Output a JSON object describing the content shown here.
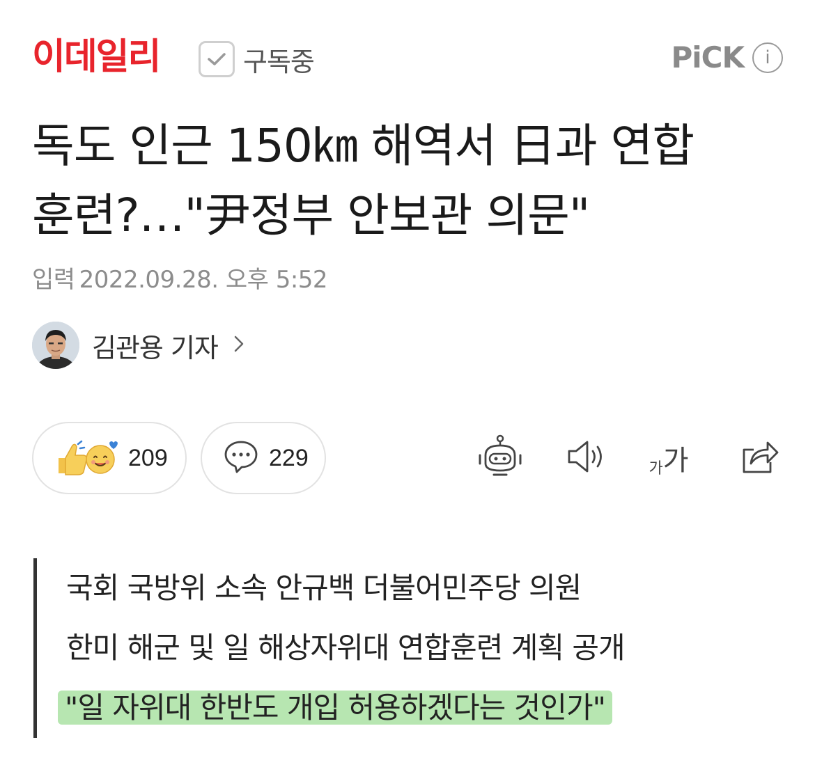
{
  "header": {
    "publisher": "이데일리",
    "subscribe_label": "구독중",
    "pick_label": "PiCK",
    "info_glyph": "i"
  },
  "article": {
    "headline_line1": "독도 인근 150㎞ 해역서 日과 연합",
    "headline_line2": "훈련?…\"尹정부 안보관 의문\"",
    "date_label": "입력",
    "date_value": "2022.09.28. 오후 5:52",
    "author": "김관용 기자"
  },
  "reactions": {
    "like_count": "209",
    "comment_count": "229"
  },
  "tools": {
    "font_size_small": "가",
    "font_size_large": "가"
  },
  "summary": [
    "국회 국방위 소속 안규백 더불어민주당 의원",
    "한미 해군 및 일 해상자위대 연합훈련 계획 공개",
    "\"일 자위대 한반도 개입 허용하겠다는 것인가\""
  ],
  "colors": {
    "brand": "#e8242c",
    "highlight": "#b7e6b1"
  },
  "icons": [
    "check-icon",
    "info-icon",
    "chevron-right-icon",
    "like-emoji-icon",
    "comment-icon",
    "robot-summary-icon",
    "speaker-icon",
    "font-size-icon",
    "share-icon"
  ]
}
